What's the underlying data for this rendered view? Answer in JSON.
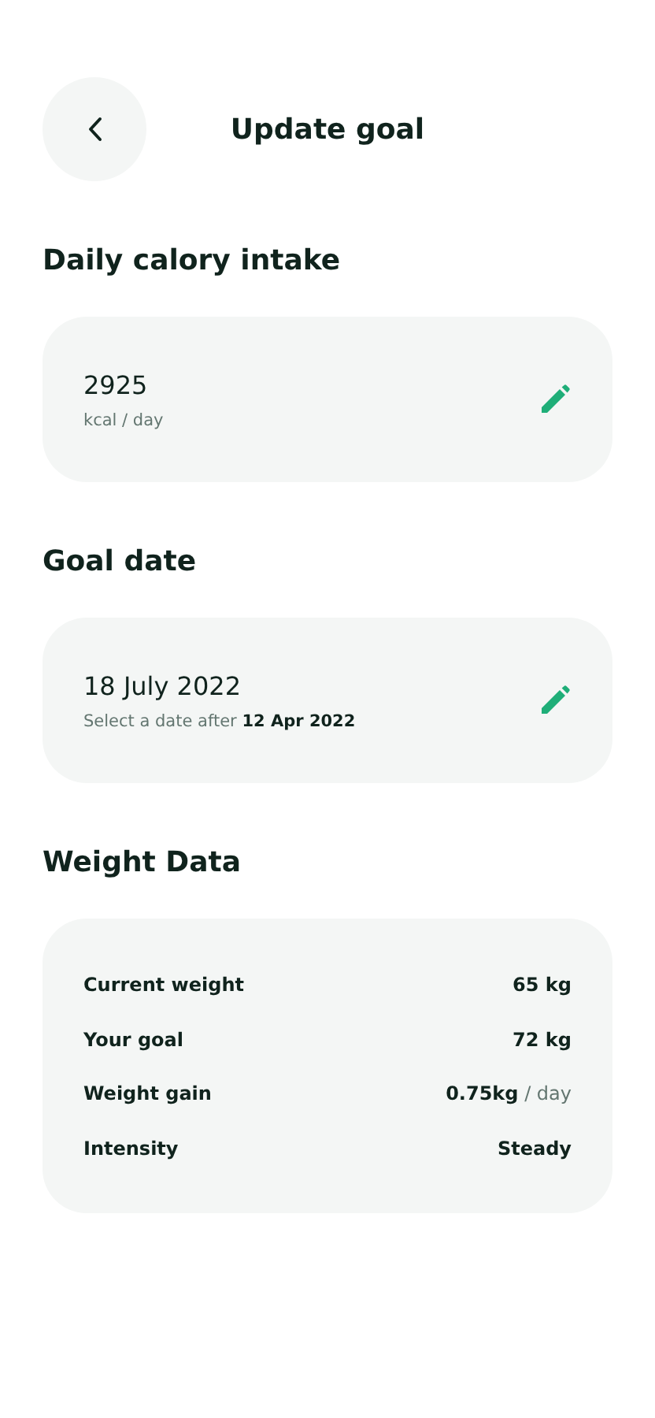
{
  "header": {
    "title": "Update goal"
  },
  "calories": {
    "heading": "Daily calory intake",
    "value": "2925",
    "caption": "kcal / day"
  },
  "goal_date": {
    "heading": "Goal date",
    "value": "18 July 2022",
    "caption": "Select a date after **12 Apr 2022**"
  },
  "weight_data": {
    "heading": "Weight Data",
    "rows": [
      {
        "label": "Current weight",
        "value": "65 kg"
      },
      {
        "label": "Your goal",
        "value": "72 kg"
      },
      {
        "label": "Weight gain",
        "value": "0.75kg",
        "unit": "/ day"
      },
      {
        "label": "Intensity",
        "value": "Steady"
      }
    ]
  }
}
